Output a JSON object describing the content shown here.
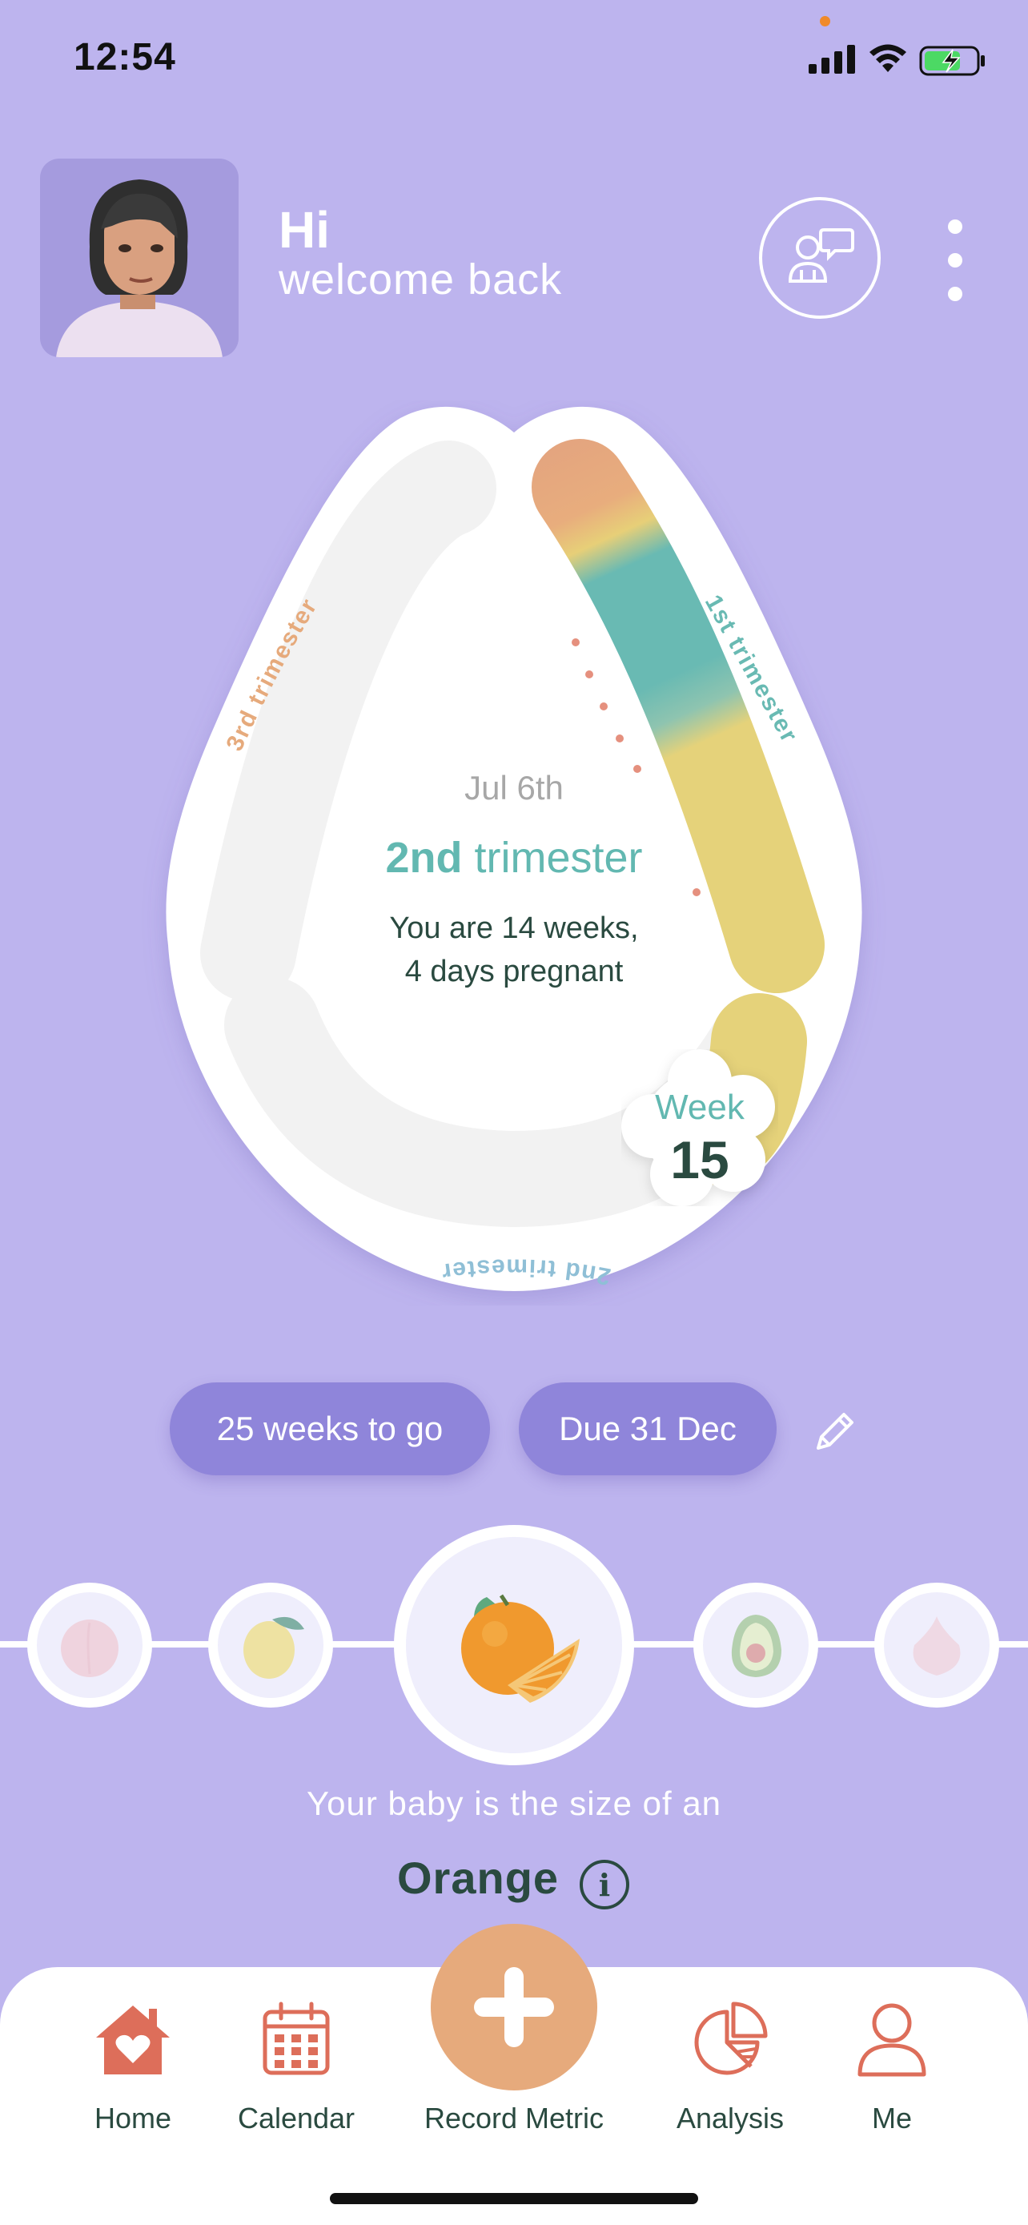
{
  "status_bar": {
    "time": "12:54"
  },
  "header": {
    "greeting": "Hi",
    "subtitle": "welcome back"
  },
  "dial": {
    "date": "Jul 6th",
    "trimester_number": "2nd",
    "trimester_word": "trimester",
    "weeks_line1": "You are 14 weeks,",
    "weeks_line2": "4 days pregnant",
    "arc_labels": [
      "1st trimester",
      "2nd trimester",
      "3rd trimester"
    ],
    "week_label": "Week",
    "week_number": "15"
  },
  "pills": {
    "weeks_to_go": "25 weeks to go",
    "due": "Due 31 Dec"
  },
  "fruit": {
    "caption": "Your baby is the size of an",
    "name": "Orange",
    "carousel": [
      "peach-icon",
      "lemon-icon",
      "orange-icon",
      "avocado-icon",
      "onion-icon"
    ]
  },
  "tabs": {
    "home": "Home",
    "calendar": "Calendar",
    "record": "Record Metric",
    "analysis": "Analysis",
    "me": "Me"
  },
  "colors": {
    "background": "#bdb4ee",
    "pill": "#8f85da",
    "teal": "#62b8b1",
    "dark_green": "#2a4a40",
    "accent_orange": "#e6aa7c",
    "tab_icon": "#dd6e5a"
  }
}
